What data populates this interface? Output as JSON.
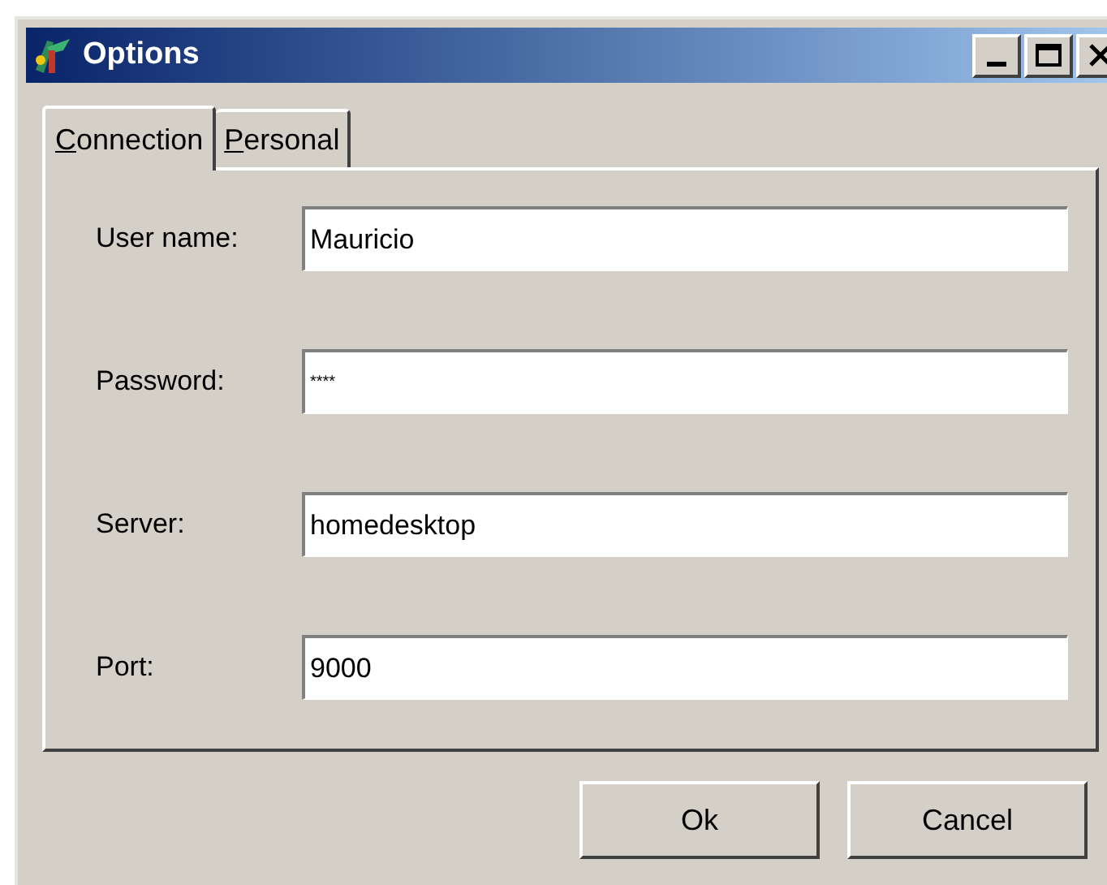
{
  "window": {
    "title": "Options"
  },
  "tabs": [
    {
      "label": "Connection",
      "selected": true
    },
    {
      "label": "Personal",
      "selected": false
    }
  ],
  "fields": [
    {
      "label": "User name:",
      "value": "Mauricio"
    },
    {
      "label": "Password:",
      "value": "****"
    },
    {
      "label": "Server:",
      "value": "homedesktop"
    },
    {
      "label": "Port:",
      "value": "9000"
    }
  ],
  "buttons": [
    "Ok",
    "Cancel"
  ]
}
